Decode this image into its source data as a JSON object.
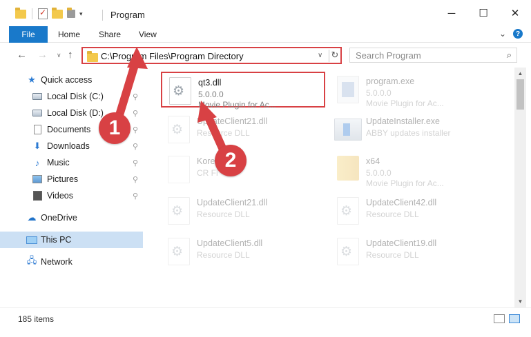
{
  "titlebar": {
    "title": "Program",
    "minimize": "─",
    "maximize": "☐",
    "close": "✕"
  },
  "ribbon": {
    "tabs": [
      "File",
      "Home",
      "Share",
      "View"
    ],
    "expand_icon": "⌄",
    "help_icon": "?"
  },
  "navbar": {
    "back": "←",
    "forward": "→",
    "recent": "∨",
    "up": "↑",
    "address": "C:\\Program Files\\Program Directory",
    "address_dropdown": "∨",
    "refresh": "↻",
    "search_placeholder": "Search Program",
    "search_icon": "⌕"
  },
  "sidebar": {
    "items": [
      {
        "label": "Quick access",
        "icon": "star-icon"
      },
      {
        "label": "Local Disk (C:)",
        "icon": "drive-icon"
      },
      {
        "label": "Local Disk (D:)",
        "icon": "drive-icon"
      },
      {
        "label": "Documents",
        "icon": "documents-icon"
      },
      {
        "label": "Downloads",
        "icon": "download-icon"
      },
      {
        "label": "Music",
        "icon": "music-icon"
      },
      {
        "label": "Pictures",
        "icon": "pictures-icon"
      },
      {
        "label": "Videos",
        "icon": "videos-icon"
      },
      {
        "label": "OneDrive",
        "icon": "cloud-icon"
      },
      {
        "label": "This PC",
        "icon": "computer-icon"
      },
      {
        "label": "Network",
        "icon": "network-icon"
      }
    ],
    "pin_glyph": "📌",
    "selected": "This PC"
  },
  "files": [
    {
      "name": "qt3.dll",
      "line1": "5.0.0.0",
      "line2": "Movie Plugin for Ac...",
      "icon": "gear-icon"
    },
    {
      "name": "program.exe",
      "line1": "5.0.0.0",
      "line2": "Movie Plugin for Ac...",
      "icon": "exe-icon"
    },
    {
      "name": "UpdateClient21.dll",
      "line1": "Resource DLL",
      "line2": "",
      "icon": "gear-icon"
    },
    {
      "name": "UpdateInstaller.exe",
      "line1": "ABBY updates installer",
      "line2": "",
      "icon": "installer-icon"
    },
    {
      "name": "Kore",
      "line1": "CR Fi",
      "line2": "",
      "icon": "blank-file-icon"
    },
    {
      "name": "x64",
      "line1": "5.0.0.0",
      "line2": "Movie Plugin for Ac...",
      "icon": "folder-icon"
    },
    {
      "name": "UpdateClient21.dll",
      "line1": "Resource DLL",
      "line2": "",
      "icon": "gear-icon"
    },
    {
      "name": "UpdateClient42.dll",
      "line1": "Resource DLL",
      "line2": "",
      "icon": "gear-icon"
    },
    {
      "name": "UpdateClient5.dll",
      "line1": "Resource DLL",
      "line2": "",
      "icon": "gear-icon"
    },
    {
      "name": "UpdateClient19.dll",
      "line1": "Resource DLL",
      "line2": "",
      "icon": "gear-icon"
    }
  ],
  "statusbar": {
    "item_count": "185 items"
  },
  "annotations": {
    "step1": "1",
    "step2": "2",
    "color": "#d84144"
  }
}
